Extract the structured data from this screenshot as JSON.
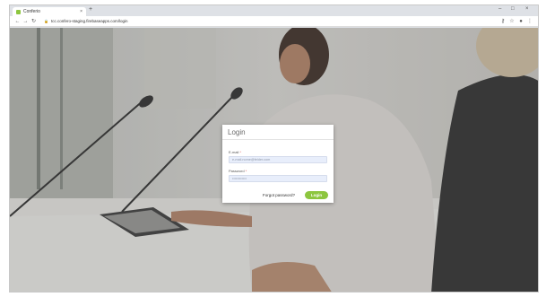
{
  "browser": {
    "tab_title": "Conferio",
    "tab_close": "×",
    "new_tab": "+",
    "url": "tcc.confero-staging.firebaseapps.com/login",
    "window_controls": [
      "–",
      "□",
      "×"
    ],
    "nav": {
      "back": "←",
      "forward": "→",
      "reload": "↻"
    },
    "icons": [
      "key-icon",
      "star-icon",
      "profile-icon",
      "menu-icon"
    ],
    "icon_glyphs": {
      "key": "⚷",
      "star": "☆",
      "profile": "●",
      "menu": "⋮"
    }
  },
  "login": {
    "title": "Login",
    "email_label": "E-mail",
    "required_mark": "*",
    "email_value": "e-mail.nome@felder.com",
    "password_label": "Password",
    "password_value": "••••••••••••",
    "forgot_label": "Forgot password?",
    "login_button": "Login"
  },
  "colors": {
    "accent": "#8dc63f",
    "input_bg": "#e8eefb"
  }
}
